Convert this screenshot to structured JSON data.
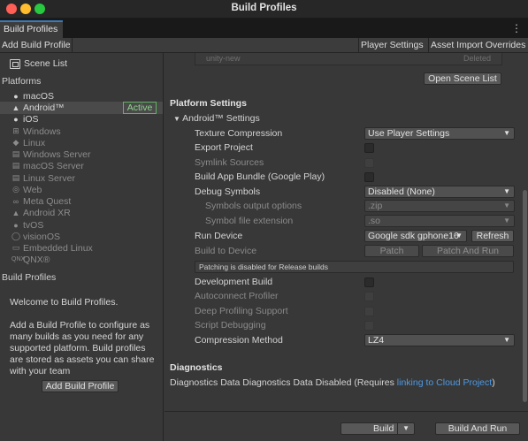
{
  "window": {
    "title": "Build Profiles"
  },
  "tab": {
    "label": "Build Profiles"
  },
  "toolbar": {
    "add_build_profile": "Add Build Profile",
    "player_settings": "Player Settings",
    "asset_import_overrides": "Asset Import Overrides"
  },
  "sidebar": {
    "scene_list": "Scene List",
    "platforms_header": "Platforms",
    "platforms": [
      {
        "label": "macOS",
        "icon": "apple-icon",
        "enabled": true
      },
      {
        "label": "Android™",
        "icon": "android-icon",
        "enabled": true,
        "selected": true
      },
      {
        "label": "iOS",
        "icon": "apple-icon",
        "enabled": true
      },
      {
        "label": "Windows",
        "icon": "windows-icon",
        "enabled": false
      },
      {
        "label": "Linux",
        "icon": "linux-icon",
        "enabled": false
      },
      {
        "label": "Windows Server",
        "icon": "windows-icon",
        "enabled": false
      },
      {
        "label": "macOS Server",
        "icon": "server-icon",
        "enabled": false
      },
      {
        "label": "Linux Server",
        "icon": "server-icon",
        "enabled": false
      },
      {
        "label": "Web",
        "icon": "web-icon",
        "enabled": false
      },
      {
        "label": "Meta Quest",
        "icon": "meta-icon",
        "enabled": false
      },
      {
        "label": "Android XR",
        "icon": "android-icon",
        "enabled": false
      },
      {
        "label": "tvOS",
        "icon": "apple-icon",
        "enabled": false
      },
      {
        "label": "visionOS",
        "icon": "visionos-icon",
        "enabled": false
      },
      {
        "label": "Embedded Linux",
        "icon": "embedded-icon",
        "enabled": false
      },
      {
        "label": "QNX®",
        "icon": "qnx-icon",
        "enabled": false
      }
    ],
    "active_badge": "Active",
    "build_profiles_header": "Build Profiles",
    "welcome_title": "Welcome to Build Profiles.",
    "welcome_body": "Add a Build Profile to configure as many builds as you need for any supported platform. Build profiles are stored as assets you can share with your team",
    "add_build_profile_button": "Add Build Profile"
  },
  "main": {
    "cut_row": {
      "left": "unity-new",
      "right": "Deleted"
    },
    "open_scene_list": "Open Scene List",
    "platform_settings_title": "Platform Settings",
    "android_settings_label": "Android™ Settings",
    "texture_compression": {
      "label": "Texture Compression",
      "value": "Use Player Settings"
    },
    "export_project": {
      "label": "Export Project"
    },
    "symlink_sources": {
      "label": "Symlink Sources"
    },
    "build_app_bundle": {
      "label": "Build App Bundle (Google Play)"
    },
    "debug_symbols": {
      "label": "Debug Symbols",
      "value": "Disabled (None)"
    },
    "symbols_output": {
      "label": "Symbols output options",
      "value": ".zip"
    },
    "symbol_ext": {
      "label": "Symbol file extension",
      "value": ".so"
    },
    "run_device": {
      "label": "Run Device",
      "value": "Google sdk gphone16",
      "refresh": "Refresh"
    },
    "build_to_device": {
      "label": "Build to Device",
      "patch": "Patch",
      "patch_and_run": "Patch And Run"
    },
    "patching_info": "Patching is disabled for Release builds",
    "development_build": {
      "label": "Development Build"
    },
    "autoconnect_profiler": {
      "label": "Autoconnect Profiler"
    },
    "deep_profiling": {
      "label": "Deep Profiling Support"
    },
    "script_debugging": {
      "label": "Script Debugging"
    },
    "compression_method": {
      "label": "Compression Method",
      "value": "LZ4"
    },
    "diagnostics_title": "Diagnostics",
    "diagnostics_text": "Diagnostics Data Diagnostics Data Disabled (Requires ",
    "diagnostics_link": "linking to Cloud Project",
    "diagnostics_close": ")",
    "build_button": "Build",
    "build_and_run_button": "Build And Run"
  },
  "colors": {
    "accent": "#3a79bb",
    "active_badge": "#62b462",
    "link": "#4c9ae6"
  }
}
